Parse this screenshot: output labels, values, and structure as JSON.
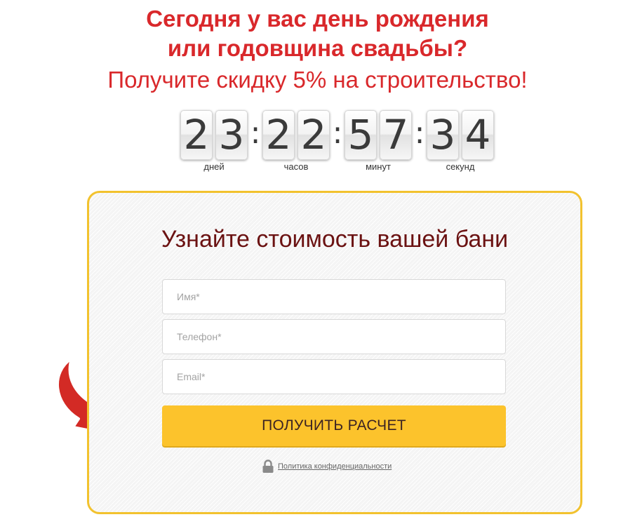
{
  "headline": {
    "line1": "Сегодня у вас день рождения",
    "line2": "или годовщина свадьбы?",
    "subline": "Получите скидку 5% на строительство!"
  },
  "countdown": {
    "days": {
      "d1": "2",
      "d2": "3",
      "label": "дней"
    },
    "hours": {
      "d1": "2",
      "d2": "2",
      "label": "часов"
    },
    "minutes": {
      "d1": "5",
      "d2": "7",
      "label": "минут"
    },
    "seconds": {
      "d1": "3",
      "d2": "4",
      "label": "секунд"
    },
    "separator": ":"
  },
  "form": {
    "title": "Узнайте стоимость вашей бани",
    "name_placeholder": "Имя*",
    "phone_placeholder": "Телефон*",
    "email_placeholder": "Email*",
    "submit_label": "ПОЛУЧИТЬ РАСЧЕТ",
    "privacy_link": "Политика конфиденциальности"
  },
  "icons": {
    "arrow": "red-curved-arrow-icon",
    "lock": "lock-icon"
  },
  "colors": {
    "headline": "#d9282b",
    "form_border": "#f2c22e",
    "button": "#fcc32c",
    "form_title": "#6b1212"
  }
}
